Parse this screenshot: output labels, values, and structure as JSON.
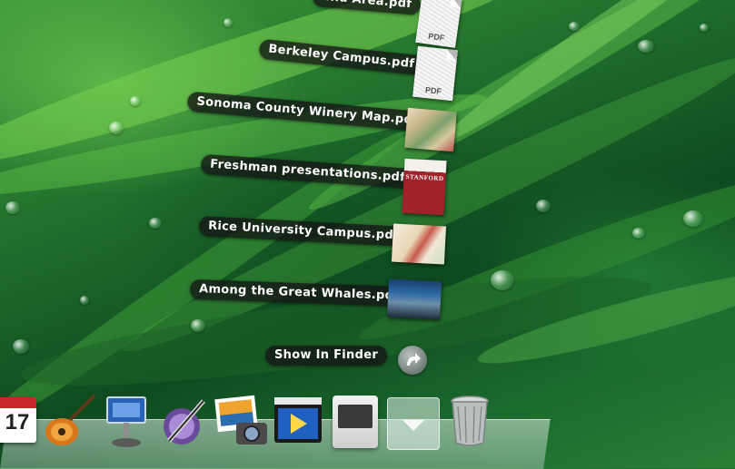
{
  "stack": {
    "items": [
      {
        "label": "...a Area.pdf",
        "tag": "PDF"
      },
      {
        "label": "Berkeley Campus.pdf",
        "tag": "PDF"
      },
      {
        "label": "Sonoma County Winery Map.pdf"
      },
      {
        "label": "Freshman presentations.pdf",
        "cover_text": "STANFORD"
      },
      {
        "label": "Rice University Campus.pdf"
      },
      {
        "label": "Among the Great Whales.pdf"
      }
    ],
    "show_in_finder": "Show In Finder"
  },
  "dock": {
    "calendar_day": "17",
    "apps": [
      "calendar-icon",
      "garageband-icon",
      "keynote-icon",
      "pen-app-icon",
      "iphoto-icon",
      "imovie-icon",
      "app-store-icon",
      "stack-arrow-icon",
      "trash-icon"
    ]
  },
  "colors": {
    "label_bg": "#141414",
    "stanford_red": "#a0222b"
  }
}
